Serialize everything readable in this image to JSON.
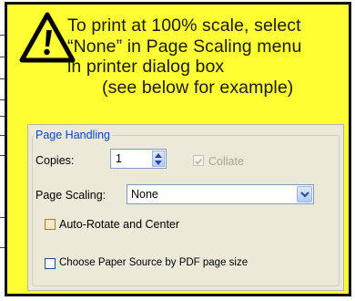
{
  "notice": {
    "message_lines": [
      "To print at 100% scale, select",
      "“None” in Page Scaling menu",
      "in printer dialog box",
      "(see below for example)"
    ],
    "icon": "warning-triangle-icon",
    "background_color": "#ffff33"
  },
  "dialog": {
    "group_title": "Page Handling",
    "copies_label": "Copies:",
    "copies_value": "1",
    "collate_label": "Collate",
    "collate_checked": true,
    "collate_enabled": false,
    "scaling_label": "Page Scaling:",
    "scaling_value": "None",
    "auto_rotate_label": "Auto-Rotate and Center",
    "auto_rotate_checked": false,
    "paper_source_label": "Choose Paper Source by PDF page size",
    "paper_source_checked": false
  }
}
